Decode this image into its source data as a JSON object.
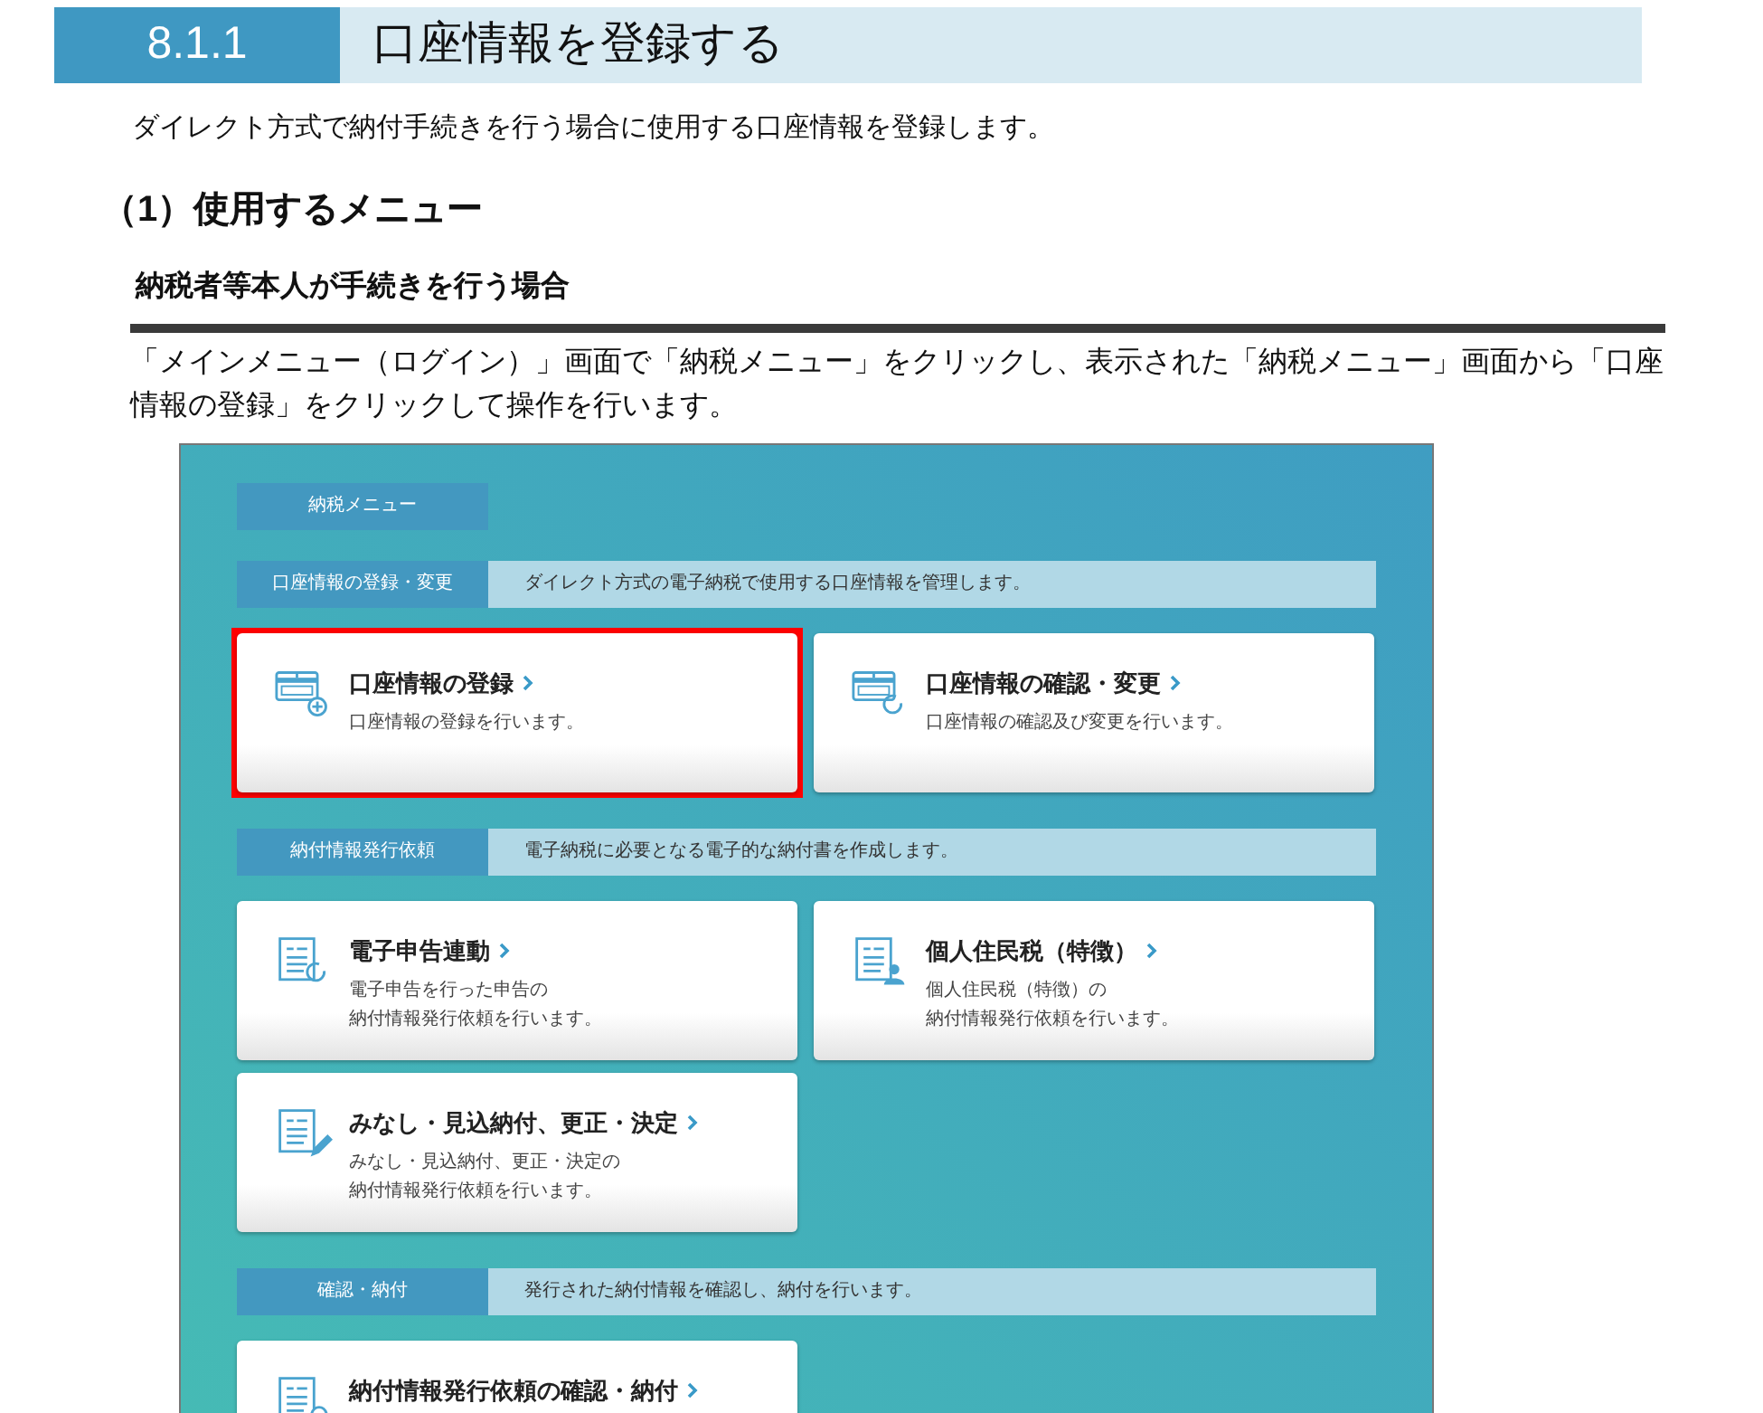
{
  "heading": {
    "number": "8.1.1",
    "title": "口座情報を登録する"
  },
  "intro": "ダイレクト方式で納付手続きを行う場合に使用する口座情報を登録します。",
  "subsection_title": "（1）使用するメニュー",
  "case_title": "納税者等本人が手続きを行う場合",
  "instruction": "「メインメニュー（ログイン）」画面で「納税メニュー」をクリックし、表示された「納税メニュー」画面から「口座情報の登録」をクリックして操作を行います。",
  "screenshot": {
    "menu_title": "納税メニュー",
    "sections": [
      {
        "label": "口座情報の登録・変更",
        "description": "ダイレクト方式の電子納税で使用する口座情報を管理します。",
        "cards": [
          {
            "kind": "bank-plus",
            "title": "口座情報の登録",
            "description": [
              "口座情報の登録を行います。"
            ],
            "selected": true
          },
          {
            "kind": "bank-refresh",
            "title": "口座情報の確認・変更",
            "description": [
              "口座情報の確認及び変更を行います。"
            ],
            "selected": false
          }
        ]
      },
      {
        "label": "納付情報発行依頼",
        "description": "電子納税に必要となる電子的な納付書を作成します。",
        "cards": [
          {
            "kind": "doc-refresh",
            "title": "電子申告連動",
            "description": [
              "電子申告を行った申告の",
              "納付情報発行依頼を行います。"
            ],
            "selected": false
          },
          {
            "kind": "doc-person",
            "title": "個人住民税（特徴）",
            "description": [
              "個人住民税（特徴）の",
              "納付情報発行依頼を行います。"
            ],
            "selected": false
          },
          {
            "kind": "doc-pen",
            "title": "みなし・見込納付、更正・決定",
            "description": [
              "みなし・見込納付、更正・決定の",
              "納付情報発行依頼を行います。"
            ],
            "selected": false
          }
        ]
      },
      {
        "label": "確認・納付",
        "description": "発行された納付情報を確認し、納付を行います。",
        "cards": [
          {
            "kind": "doc-bell",
            "title": "納付情報発行依頼の確認・納付",
            "selected": false
          }
        ]
      }
    ]
  }
}
